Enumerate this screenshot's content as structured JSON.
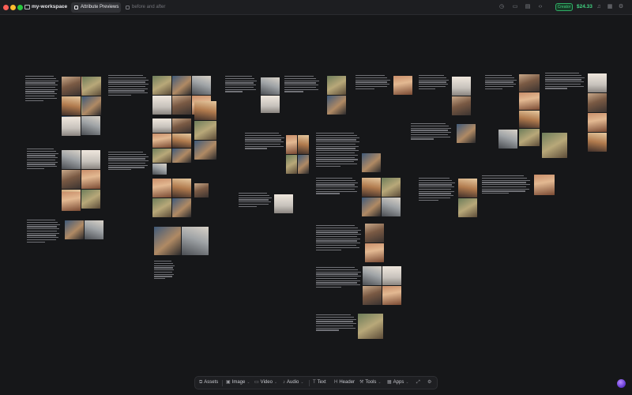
{
  "titlebar": {
    "workspace": "my-workspace",
    "tabs": [
      {
        "label": "Attribute Previews",
        "active": true
      },
      {
        "label": "before and after",
        "active": false
      }
    ],
    "badge": "Creator",
    "credits": "$24.33"
  },
  "toolbar": {
    "assets": "Assets",
    "image": "Image",
    "video": "Video",
    "audio": "Audio",
    "text": "Text",
    "header": "Header",
    "tools": "Tools",
    "apps": "Apps"
  },
  "colors": {
    "background": "#161719",
    "accent_green": "#41d382",
    "avatar_purple": "#7b4fe0"
  }
}
